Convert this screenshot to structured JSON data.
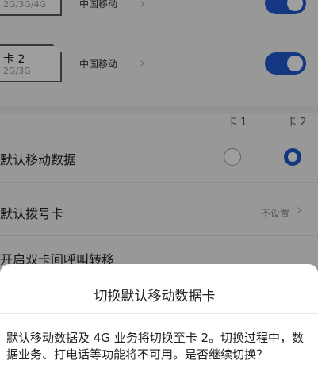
{
  "sims": [
    {
      "name": "",
      "type": "2G/3G/4G",
      "carrier": "中国移动",
      "enabled": true
    },
    {
      "name": "卡 2",
      "type": "2G/3G",
      "carrier": "中国移动",
      "enabled": true
    }
  ],
  "columns": {
    "card1": "卡 1",
    "card2": "卡 2"
  },
  "settings": {
    "default_data": {
      "label": "默认移动数据",
      "selected": "卡 2"
    },
    "default_dial": {
      "label": "默认拨号卡",
      "value": "不设置"
    },
    "call_forward": {
      "label": "开启双卡间呼叫转移"
    }
  },
  "dialog": {
    "title": "切换默认移动数据卡",
    "message": "默认移动数据及 4G 业务将切换至卡 2。切换过程中，数据业务、打电话等功能将不可用。是否继续切换？"
  },
  "colors": {
    "accent": "#1f5bd0",
    "background": "#f6f6f6",
    "dialog_bg": "#ffffff"
  }
}
